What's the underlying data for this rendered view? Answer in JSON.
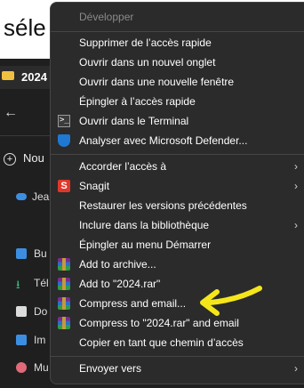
{
  "background": {
    "title_fragment": "séle",
    "tab_label": "2024",
    "new_label": "Nou",
    "user_label": "Jea",
    "sidebar_items": [
      "Bu",
      "Tél",
      "Do",
      "Im",
      "Mu"
    ]
  },
  "menu": {
    "header": "Développer",
    "group1": [
      {
        "label": "Supprimer de l’accès rapide",
        "icon": ""
      },
      {
        "label": "Ouvrir dans un nouvel onglet",
        "icon": ""
      },
      {
        "label": "Ouvrir dans une nouvelle fenêtre",
        "icon": ""
      },
      {
        "label": "Épingler à l’accès rapide",
        "icon": ""
      },
      {
        "label": "Ouvrir dans le Terminal",
        "icon": "terminal-icon"
      },
      {
        "label": "Analyser avec Microsoft Defender...",
        "icon": "defender-shield-icon"
      }
    ],
    "group2": [
      {
        "label": "Accorder l’accès à",
        "icon": "",
        "submenu": true
      },
      {
        "label": "Snagit",
        "icon": "snagit-icon",
        "submenu": true
      },
      {
        "label": "Restaurer les versions précédentes",
        "icon": ""
      },
      {
        "label": "Inclure dans la bibliothèque",
        "icon": "",
        "submenu": true
      },
      {
        "label": "Épingler au menu Démarrer",
        "icon": ""
      },
      {
        "label": "Add to archive...",
        "icon": "winrar-icon"
      },
      {
        "label": "Add to \"2024.rar\"",
        "icon": "winrar-icon"
      },
      {
        "label": "Compress and email...",
        "icon": "winrar-icon"
      },
      {
        "label": "Compress to \"2024.rar\" and email",
        "icon": "winrar-icon"
      },
      {
        "label": "Copier en tant que chemin d’accès",
        "icon": ""
      }
    ],
    "group3": [
      {
        "label": "Envoyer vers",
        "icon": "",
        "submenu": true
      }
    ],
    "submenu_arrow": "›"
  },
  "colors": {
    "menu_bg": "#2b2b2b",
    "annotation_arrow": "#f5e61c"
  }
}
